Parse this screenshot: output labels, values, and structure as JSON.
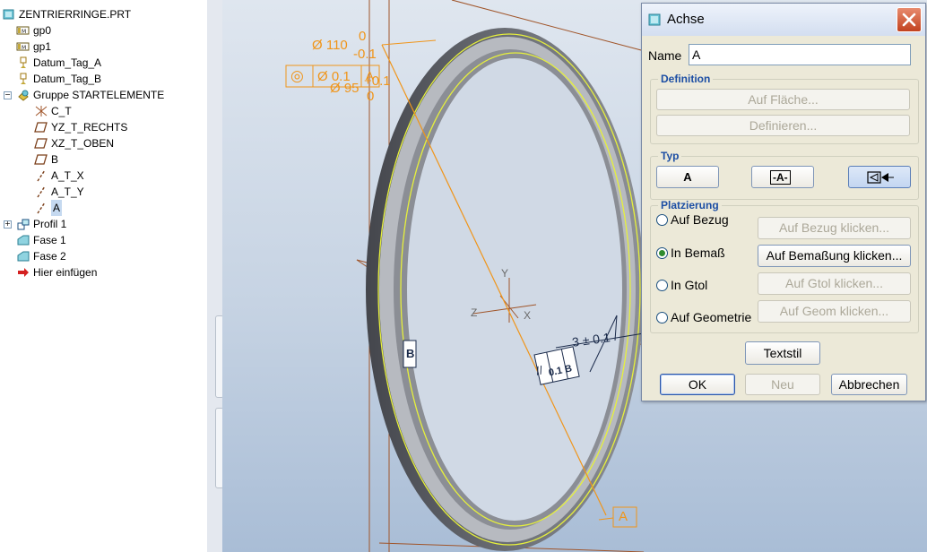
{
  "model_tree": {
    "root": "ZENTRIERRINGE.PRT",
    "items": [
      {
        "label": "gp0",
        "icon": "plane-icon"
      },
      {
        "label": "gp1",
        "icon": "plane-icon"
      },
      {
        "label": "Datum_Tag_A",
        "icon": "datum-tag-icon"
      },
      {
        "label": "Datum_Tag_B",
        "icon": "datum-tag-icon"
      },
      {
        "label": "Gruppe STARTELEMENTE",
        "icon": "group-icon"
      },
      {
        "label": "C_T",
        "icon": "csys-icon"
      },
      {
        "label": "YZ_T_RECHTS",
        "icon": "datum-plane-icon"
      },
      {
        "label": "XZ_T_OBEN",
        "icon": "datum-plane-icon"
      },
      {
        "label": "B",
        "icon": "datum-plane-icon"
      },
      {
        "label": "A_T_X",
        "icon": "axis-icon"
      },
      {
        "label": "A_T_Y",
        "icon": "axis-icon"
      },
      {
        "label": "A",
        "icon": "axis-icon"
      },
      {
        "label": "Profil 1",
        "icon": "profile-icon"
      },
      {
        "label": "Fase 1",
        "icon": "chamfer-icon"
      },
      {
        "label": "Fase 2",
        "icon": "chamfer-icon"
      },
      {
        "label": "Hier einfügen",
        "icon": "insert-arrow-icon"
      }
    ]
  },
  "viewport": {
    "dim_outer_symbol": "Ø 110",
    "dim_outer_upper": "0",
    "dim_outer_lower": "-0.1",
    "gtol_symbol": "◎",
    "gtol_value": "Ø 0.1",
    "gtol_ref": "A",
    "dim_inner_symbol": "Ø 95",
    "dim_inner_upper": "+0.1",
    "dim_inner_lower": "0",
    "datum_b": "B",
    "datum_a": "A",
    "thickness_dim": "3 ± 0.1",
    "parallel_symbol": "//",
    "parallel_value": "0.1",
    "parallel_ref": "B",
    "axis_y": "Y",
    "axis_z": "Z",
    "axis_x": "X",
    "colors": {
      "annotation": "#f0951a",
      "ring_dark": "#5e6168",
      "ring_light": "#b9bcc2",
      "highlight": "#e6f03c",
      "datum_lines": "#a0552a"
    }
  },
  "dialog": {
    "title": "Achse",
    "name_label": "Name",
    "name_value": "A",
    "definition_legend": "Definition",
    "btn_auf_flaeche": "Auf Fläche...",
    "btn_definieren": "Definieren...",
    "typ_legend": "Typ",
    "typ_a": "A",
    "typ_b": "-A-",
    "platzierung_legend": "Platzierung",
    "radio_auf_bezug": "Auf Bezug",
    "radio_in_bemass": "In Bemaß",
    "radio_in_gtol": "In Gtol",
    "radio_auf_geometrie": "Auf Geometrie",
    "btn_auf_bezug": "Auf Bezug klicken...",
    "btn_auf_bemassung": "Auf Bemaßung klicken...",
    "btn_auf_gtol": "Auf Gtol klicken...",
    "btn_auf_geom": "Auf Geom klicken...",
    "btn_textstil": "Textstil",
    "btn_ok": "OK",
    "btn_neu": "Neu",
    "btn_abbrechen": "Abbrechen"
  }
}
